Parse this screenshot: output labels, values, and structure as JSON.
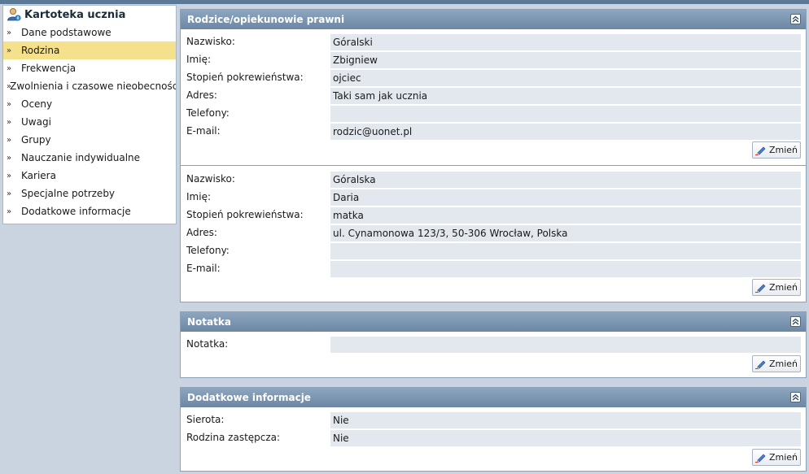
{
  "sidebar": {
    "title": "Kartoteka ucznia",
    "items": [
      {
        "label": "Dane podstawowe",
        "active": false
      },
      {
        "label": "Rodzina",
        "active": true
      },
      {
        "label": "Frekwencja",
        "active": false
      },
      {
        "label": "Zwolnienia i czasowe nieobecności",
        "active": false
      },
      {
        "label": "Oceny",
        "active": false
      },
      {
        "label": "Uwagi",
        "active": false
      },
      {
        "label": "Grupy",
        "active": false
      },
      {
        "label": "Nauczanie indywidualne",
        "active": false
      },
      {
        "label": "Kariera",
        "active": false
      },
      {
        "label": "Specjalne potrzeby",
        "active": false
      },
      {
        "label": "Dodatkowe informacje",
        "active": false
      }
    ],
    "chevron": "»"
  },
  "guardians": {
    "title": "Rodzice/opiekunowie prawni",
    "button_label": "Zmień",
    "records": [
      {
        "fields": [
          {
            "label": "Nazwisko:",
            "value": "Góralski"
          },
          {
            "label": "Imię:",
            "value": "Zbigniew"
          },
          {
            "label": "Stopień pokrewieństwa:",
            "value": "ojciec"
          },
          {
            "label": "Adres:",
            "value": "Taki sam jak ucznia"
          },
          {
            "label": "Telefony:",
            "value": ""
          },
          {
            "label": "E-mail:",
            "value": "rodzic@uonet.pl"
          }
        ]
      },
      {
        "fields": [
          {
            "label": "Nazwisko:",
            "value": "Góralska"
          },
          {
            "label": "Imię:",
            "value": "Daria"
          },
          {
            "label": "Stopień pokrewieństwa:",
            "value": "matka"
          },
          {
            "label": "Adres:",
            "value": "ul. Cynamonowa 123/3, 50-306 Wrocław, Polska"
          },
          {
            "label": "Telefony:",
            "value": ""
          },
          {
            "label": "E-mail:",
            "value": ""
          }
        ]
      }
    ]
  },
  "note": {
    "title": "Notatka",
    "button_label": "Zmień",
    "fields": [
      {
        "label": "Notatka:",
        "value": ""
      }
    ]
  },
  "additional": {
    "title": "Dodatkowe informacje",
    "button_label": "Zmień",
    "fields": [
      {
        "label": "Sierota:",
        "value": "Nie"
      },
      {
        "label": "Rodzina zastępcza:",
        "value": "Nie"
      }
    ]
  },
  "icons": {
    "collapse": "double-chevron-up-icon",
    "edit": "pencil-icon",
    "user": "user-icon"
  },
  "colors": {
    "header": "#7892ae",
    "active_item": "#f5e08c",
    "value_bg": "#e3e8ee"
  }
}
